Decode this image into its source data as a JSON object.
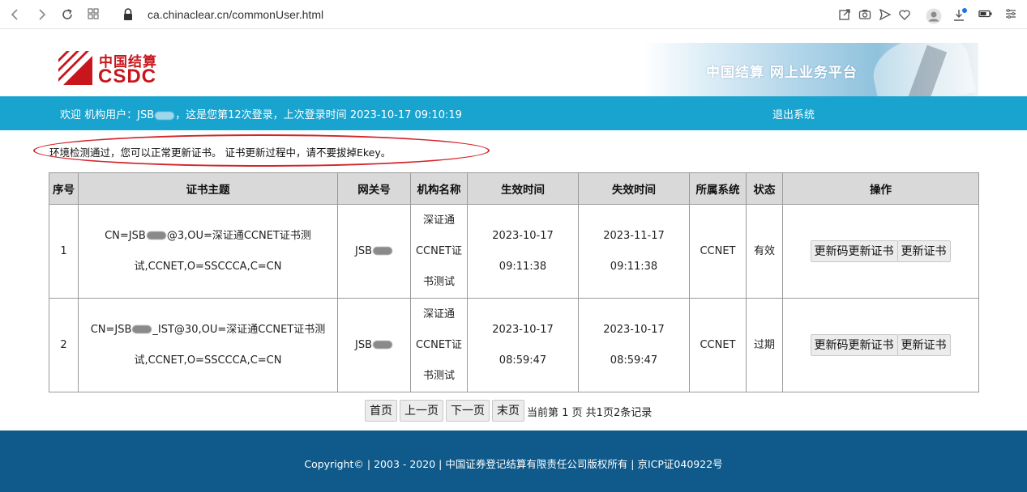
{
  "browser": {
    "url": "ca.chinaclear.cn/commonUser.html",
    "icons": [
      "back-icon",
      "forward-icon",
      "reload-icon",
      "apps-grid-icon",
      "lock-icon",
      "share-icon",
      "camera-icon",
      "send-icon",
      "heart-icon",
      "avatar-icon",
      "download-icon",
      "battery-icon",
      "menu-icon"
    ]
  },
  "header": {
    "logo_cn": "中国结算",
    "logo_en": "CSDC",
    "banner_title": "中国结算 网上业务平台",
    "brand_color": "#c8161d"
  },
  "welcome": {
    "prefix": "欢迎 机构用户：JSB",
    "suffix": "，这是您第12次登录，上次登录时间 2023-10-17 09:10:19",
    "logout": "退出系统",
    "bar_color": "#19a3cf"
  },
  "notice": "环境检测通过，您可以正常更新证书。 证书更新过程中，请不要拔掉Ekey。",
  "table": {
    "headers": [
      "序号",
      "证书主题",
      "网关号",
      "机构名称",
      "生效时间",
      "失效时间",
      "所属系统",
      "状态",
      "操作"
    ],
    "rows": [
      {
        "index": "1",
        "subject_a": "CN=JSB",
        "subject_b": "@3,OU=深证通CCNET证书测",
        "subject_c": "试,CCNET,O=SSCCCA,C=CN",
        "gateway": "JSB",
        "org": "深证通\nCCNET证\n书测试",
        "start": "2023-10-17 09:11:38",
        "end": "2023-11-17 09:11:38",
        "system": "CCNET",
        "status": "有效",
        "action1": "更新码更新证书",
        "action2": "更新证书"
      },
      {
        "index": "2",
        "subject_a": "CN=JSB",
        "subject_b": "_IST@30,OU=深证通CCNET证书测",
        "subject_c": "试,CCNET,O=SSCCCA,C=CN",
        "gateway": "JSB",
        "org": "深证通\nCCNET证\n书测试",
        "start": "2023-10-17 08:59:47",
        "end": "2023-10-17 08:59:47",
        "system": "CCNET",
        "status": "过期",
        "action1": "更新码更新证书",
        "action2": "更新证书"
      }
    ]
  },
  "pager": {
    "first": "首页",
    "prev": "上一页",
    "next": "下一页",
    "last": "末页",
    "info": "当前第 1 页 共1页2条记录"
  },
  "footer": {
    "text": "Copyright© | 2003 - 2020 | 中国证券登记结算有限责任公司版权所有 | 京ICP证040922号",
    "color": "#0f5a8a"
  }
}
